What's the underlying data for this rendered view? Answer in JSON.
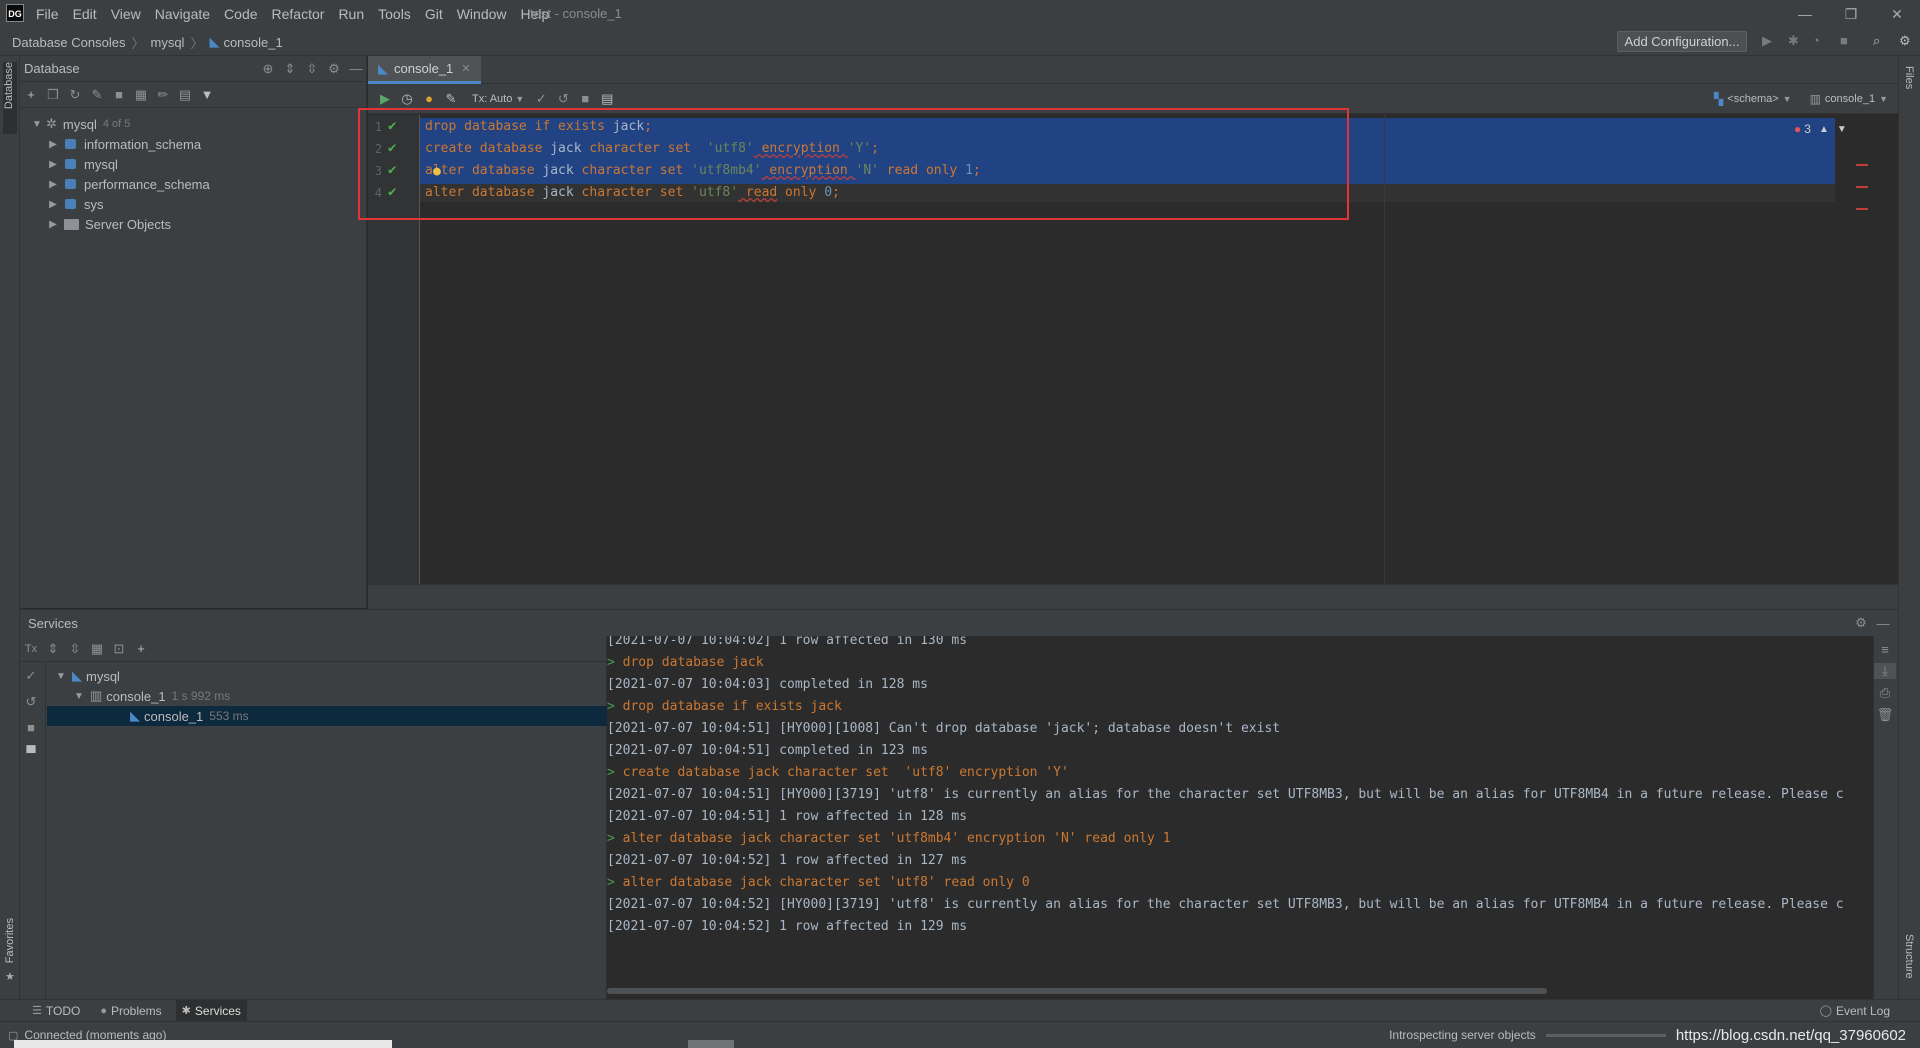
{
  "app": {
    "logo": "DG",
    "title": "test - console_1",
    "menu": [
      "File",
      "Edit",
      "View",
      "Navigate",
      "Code",
      "Refactor",
      "Run",
      "Tools",
      "Git",
      "Window",
      "Help"
    ]
  },
  "breadcrumb": [
    "Database Consoles",
    "mysql",
    "console_1"
  ],
  "toolbar": {
    "add_configuration": "Add Configuration..."
  },
  "side_strips": {
    "left_top": "Database",
    "left_bottom": "Favorites",
    "right_top": "Files",
    "right_bottom": "Structure"
  },
  "database_panel": {
    "title": "Database",
    "root": {
      "label": "mysql",
      "count": "4 of 5"
    },
    "schemas": [
      "information_schema",
      "mysql",
      "performance_schema",
      "sys"
    ],
    "server_objects": "Server Objects"
  },
  "editor": {
    "tab": "console_1",
    "tx_mode": "Tx: Auto",
    "schema_selector": "<schema>",
    "session_selector": "console_1",
    "error_count": "3",
    "lines": [
      {
        "num": "1",
        "a": "drop database if exists ",
        "b": "jack",
        "c": ";"
      },
      {
        "num": "2",
        "a": "create database ",
        "b": "jack",
        "c": " character set  ",
        "d": "'utf8'",
        "e": " encryption ",
        "f": "'Y'",
        "g": ";"
      },
      {
        "num": "3",
        "a": "alter database ",
        "b": "jack",
        "c": " character set ",
        "d": "'utf8mb4'",
        "e": " encryption ",
        "f": "'N'",
        "g": " read only ",
        "h": "1",
        "i": ";"
      },
      {
        "num": "4",
        "a": "alter database ",
        "b": "jack",
        "c": " character set ",
        "d": "'utf8'",
        "e": " read",
        "f": " only ",
        "g": "0",
        "h": ";"
      }
    ]
  },
  "services": {
    "title": "Services",
    "tree": {
      "root": "mysql",
      "console": {
        "label": "console_1",
        "time": "1 s 992 ms"
      },
      "session": {
        "label": "console_1",
        "time": "553 ms"
      }
    },
    "output": [
      {
        "type": "log",
        "text": "[2021-07-07 10:04:02] 1 row affected in 130 ms"
      },
      {
        "type": "cmd",
        "text": "drop database jack"
      },
      {
        "type": "log",
        "text": "[2021-07-07 10:04:03] completed in 128 ms"
      },
      {
        "type": "cmd",
        "text": "drop database if exists jack"
      },
      {
        "type": "log",
        "text": "[2021-07-07 10:04:51] [HY000][1008] Can't drop database 'jack'; database doesn't exist"
      },
      {
        "type": "log",
        "text": "[2021-07-07 10:04:51] completed in 123 ms"
      },
      {
        "type": "cmd",
        "text": "create database jack character set  'utf8' encryption 'Y'"
      },
      {
        "type": "log",
        "text": "[2021-07-07 10:04:51] [HY000][3719] 'utf8' is currently an alias for the character set UTF8MB3, but will be an alias for UTF8MB4 in a future release. Please c"
      },
      {
        "type": "log",
        "text": "[2021-07-07 10:04:51] 1 row affected in 128 ms"
      },
      {
        "type": "cmd",
        "text": "alter database jack character set 'utf8mb4' encryption 'N' read only 1"
      },
      {
        "type": "log",
        "text": "[2021-07-07 10:04:52] 1 row affected in 127 ms"
      },
      {
        "type": "cmd",
        "text": "alter database jack character set 'utf8' read only 0"
      },
      {
        "type": "log",
        "text": "[2021-07-07 10:04:52] [HY000][3719] 'utf8' is currently an alias for the character set UTF8MB3, but will be an alias for UTF8MB4 in a future release. Please c"
      },
      {
        "type": "log",
        "text": "[2021-07-07 10:04:52] 1 row affected in 129 ms"
      }
    ]
  },
  "bottom_tabs": [
    "TODO",
    "Problems",
    "Services"
  ],
  "event_log": "Event Log",
  "status": {
    "left": "Connected (moments ago)",
    "task": "Introspecting server objects",
    "watermark": "https://blog.csdn.net/qq_37960602"
  }
}
